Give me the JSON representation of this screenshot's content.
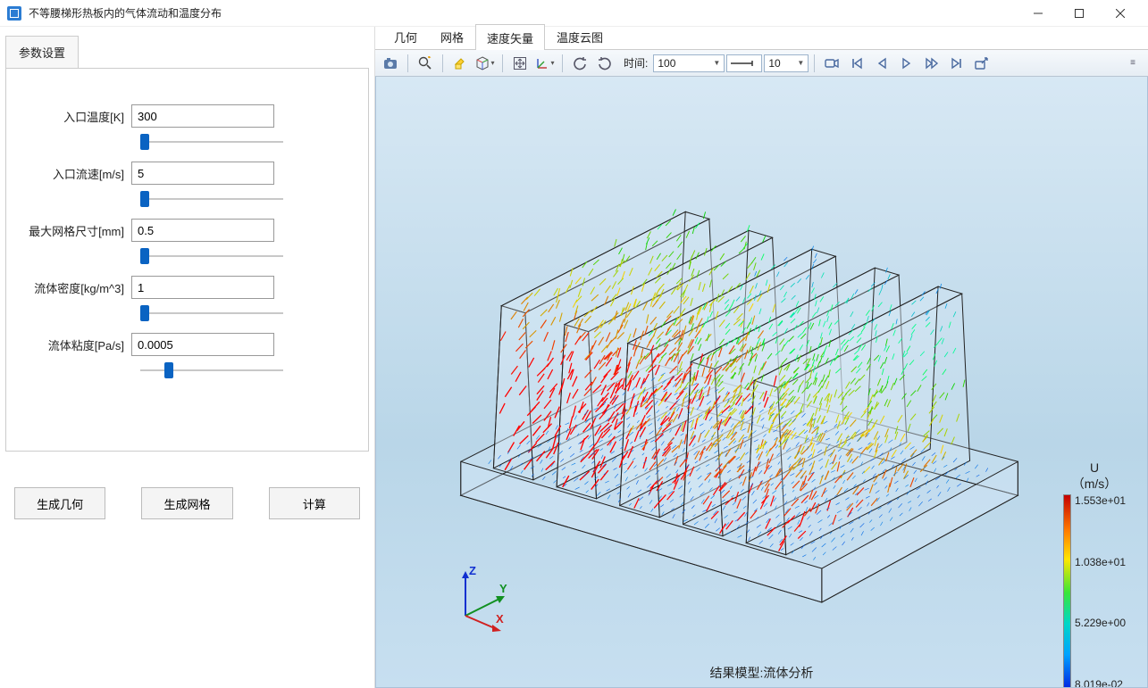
{
  "window": {
    "title": "不等腰梯形热板内的气体流动和温度分布"
  },
  "left": {
    "tab": "参数设置",
    "params": [
      {
        "label": "入口温度[K]",
        "value": "300",
        "slider": 0
      },
      {
        "label": "入口流速[m/s]",
        "value": "5",
        "slider": 0
      },
      {
        "label": "最大网格尺寸[mm]",
        "value": "0.5",
        "slider": 0
      },
      {
        "label": "流体密度[kg/m^3]",
        "value": "1",
        "slider": 0
      },
      {
        "label": "流体粘度[Pa/s]",
        "value": "0.0005",
        "slider": 18
      }
    ],
    "buttons": {
      "b1": "生成几何",
      "b2": "生成网格",
      "b3": "计算"
    }
  },
  "right_tabs": {
    "t0": "几何",
    "t1": "网格",
    "t2": "速度矢量",
    "t3": "温度云图",
    "active": 2
  },
  "toolbar": {
    "time_label": "时间:",
    "time_value": "100",
    "line_width": "10"
  },
  "viewport": {
    "caption": "结果模型:流体分析",
    "axes": {
      "x": "X",
      "y": "Y",
      "z": "Z"
    }
  },
  "colorbar": {
    "title": "U",
    "unit": "（m/s）",
    "ticks": {
      "t0": "1.553e+01",
      "t1": "1.038e+01",
      "t2": "5.229e+00",
      "t3": "8.019e-02"
    }
  }
}
